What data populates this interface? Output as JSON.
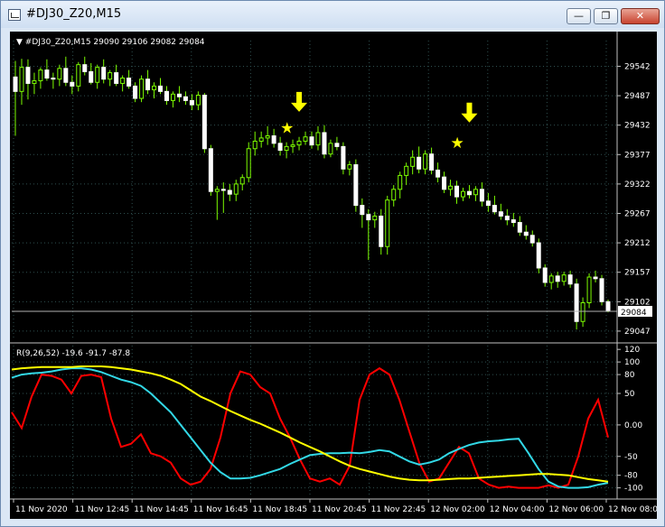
{
  "window": {
    "title": "#DJ30_Z20,M15",
    "minimize_glyph": "—",
    "maximize_glyph": "❐",
    "close_glyph": "✕"
  },
  "chart_header": {
    "symbol_info": "▼ #DJ30_Z20,M15  29090 29106 29082 29084"
  },
  "indicator_header": {
    "label": "R(9,26,52) -19.6 -91.7 -87.8"
  },
  "colors": {
    "background": "#000000",
    "candle": "#7CFC00",
    "grid": "#2f4f4f",
    "annotation": "#ffff00",
    "indicator_red": "#ff0000",
    "indicator_cyan": "#32d8e6",
    "indicator_yellow": "#ffff00"
  },
  "chart_data": [
    {
      "type": "candlestick",
      "title": "#DJ30_Z20,M15",
      "y_ticks": [
        29542,
        29487,
        29432,
        29377,
        29322,
        29267,
        29212,
        29157,
        29102,
        29047
      ],
      "ylim": [
        29030,
        29590
      ],
      "current_price": 29084,
      "x_ticks": [
        "11 Nov 2020",
        "11 Nov 12:45",
        "11 Nov 14:45",
        "11 Nov 16:45",
        "11 Nov 18:45",
        "11 Nov 20:45",
        "11 Nov 22:45",
        "12 Nov 02:00",
        "12 Nov 04:00",
        "12 Nov 06:00",
        "12 Nov 08:00"
      ],
      "grid": true,
      "annotations": [
        {
          "type": "star",
          "candle_index": 43,
          "price": 29427
        },
        {
          "type": "arrow-down",
          "candle_index": 45,
          "price": 29467
        },
        {
          "type": "star",
          "candle_index": 70,
          "price": 29399
        },
        {
          "type": "arrow-down",
          "candle_index": 72,
          "price": 29447
        }
      ],
      "candles": [
        {
          "o": 29522,
          "h": 29552,
          "l": 29412,
          "c": 29495
        },
        {
          "o": 29495,
          "h": 29556,
          "l": 29470,
          "c": 29540
        },
        {
          "o": 29540,
          "h": 29555,
          "l": 29480,
          "c": 29510
        },
        {
          "o": 29510,
          "h": 29530,
          "l": 29490,
          "c": 29515
        },
        {
          "o": 29515,
          "h": 29540,
          "l": 29500,
          "c": 29535
        },
        {
          "o": 29535,
          "h": 29555,
          "l": 29515,
          "c": 29520
        },
        {
          "o": 29520,
          "h": 29530,
          "l": 29500,
          "c": 29518
        },
        {
          "o": 29518,
          "h": 29545,
          "l": 29505,
          "c": 29538
        },
        {
          "o": 29538,
          "h": 29560,
          "l": 29505,
          "c": 29512
        },
        {
          "o": 29512,
          "h": 29525,
          "l": 29490,
          "c": 29505
        },
        {
          "o": 29505,
          "h": 29550,
          "l": 29495,
          "c": 29545
        },
        {
          "o": 29545,
          "h": 29560,
          "l": 29525,
          "c": 29532
        },
        {
          "o": 29532,
          "h": 29548,
          "l": 29508,
          "c": 29512
        },
        {
          "o": 29512,
          "h": 29545,
          "l": 29500,
          "c": 29540
        },
        {
          "o": 29540,
          "h": 29555,
          "l": 29510,
          "c": 29518
        },
        {
          "o": 29518,
          "h": 29535,
          "l": 29505,
          "c": 29530
        },
        {
          "o": 29530,
          "h": 29545,
          "l": 29505,
          "c": 29510
        },
        {
          "o": 29510,
          "h": 29525,
          "l": 29495,
          "c": 29520
        },
        {
          "o": 29520,
          "h": 29535,
          "l": 29500,
          "c": 29505
        },
        {
          "o": 29505,
          "h": 29512,
          "l": 29475,
          "c": 29482
        },
        {
          "o": 29482,
          "h": 29525,
          "l": 29475,
          "c": 29518
        },
        {
          "o": 29518,
          "h": 29535,
          "l": 29490,
          "c": 29498
        },
        {
          "o": 29498,
          "h": 29512,
          "l": 29482,
          "c": 29505
        },
        {
          "o": 29505,
          "h": 29520,
          "l": 29490,
          "c": 29495
        },
        {
          "o": 29495,
          "h": 29505,
          "l": 29470,
          "c": 29478
        },
        {
          "o": 29478,
          "h": 29495,
          "l": 29465,
          "c": 29490
        },
        {
          "o": 29490,
          "h": 29505,
          "l": 29475,
          "c": 29485
        },
        {
          "o": 29485,
          "h": 29495,
          "l": 29470,
          "c": 29478
        },
        {
          "o": 29478,
          "h": 29490,
          "l": 29460,
          "c": 29470
        },
        {
          "o": 29470,
          "h": 29495,
          "l": 29460,
          "c": 29488
        },
        {
          "o": 29488,
          "h": 29492,
          "l": 29380,
          "c": 29388
        },
        {
          "o": 29388,
          "h": 29395,
          "l": 29300,
          "c": 29308
        },
        {
          "o": 29308,
          "h": 29318,
          "l": 29255,
          "c": 29312
        },
        {
          "o": 29312,
          "h": 29325,
          "l": 29268,
          "c": 29310
        },
        {
          "o": 29310,
          "h": 29322,
          "l": 29290,
          "c": 29303
        },
        {
          "o": 29303,
          "h": 29330,
          "l": 29290,
          "c": 29322
        },
        {
          "o": 29322,
          "h": 29340,
          "l": 29310,
          "c": 29334
        },
        {
          "o": 29334,
          "h": 29400,
          "l": 29325,
          "c": 29388
        },
        {
          "o": 29388,
          "h": 29420,
          "l": 29375,
          "c": 29402
        },
        {
          "o": 29402,
          "h": 29420,
          "l": 29390,
          "c": 29408
        },
        {
          "o": 29408,
          "h": 29430,
          "l": 29395,
          "c": 29412
        },
        {
          "o": 29412,
          "h": 29425,
          "l": 29390,
          "c": 29398
        },
        {
          "o": 29398,
          "h": 29410,
          "l": 29375,
          "c": 29385
        },
        {
          "o": 29385,
          "h": 29400,
          "l": 29370,
          "c": 29392
        },
        {
          "o": 29392,
          "h": 29405,
          "l": 29380,
          "c": 29395
        },
        {
          "o": 29395,
          "h": 29410,
          "l": 29385,
          "c": 29402
        },
        {
          "o": 29402,
          "h": 29420,
          "l": 29395,
          "c": 29410
        },
        {
          "o": 29410,
          "h": 29420,
          "l": 29388,
          "c": 29395
        },
        {
          "o": 29395,
          "h": 29430,
          "l": 29385,
          "c": 29418
        },
        {
          "o": 29418,
          "h": 29432,
          "l": 29370,
          "c": 29378
        },
        {
          "o": 29378,
          "h": 29405,
          "l": 29372,
          "c": 29398
        },
        {
          "o": 29398,
          "h": 29410,
          "l": 29385,
          "c": 29392
        },
        {
          "o": 29392,
          "h": 29400,
          "l": 29340,
          "c": 29350
        },
        {
          "o": 29350,
          "h": 29365,
          "l": 29338,
          "c": 29358
        },
        {
          "o": 29358,
          "h": 29368,
          "l": 29270,
          "c": 29282
        },
        {
          "o": 29282,
          "h": 29295,
          "l": 29240,
          "c": 29265
        },
        {
          "o": 29265,
          "h": 29275,
          "l": 29180,
          "c": 29255
        },
        {
          "o": 29255,
          "h": 29270,
          "l": 29240,
          "c": 29262
        },
        {
          "o": 29262,
          "h": 29275,
          "l": 29190,
          "c": 29205
        },
        {
          "o": 29205,
          "h": 29300,
          "l": 29190,
          "c": 29292
        },
        {
          "o": 29292,
          "h": 29320,
          "l": 29280,
          "c": 29312
        },
        {
          "o": 29312,
          "h": 29345,
          "l": 29295,
          "c": 29338
        },
        {
          "o": 29338,
          "h": 29362,
          "l": 29320,
          "c": 29355
        },
        {
          "o": 29355,
          "h": 29385,
          "l": 29340,
          "c": 29372
        },
        {
          "o": 29372,
          "h": 29392,
          "l": 29342,
          "c": 29350
        },
        {
          "o": 29350,
          "h": 29385,
          "l": 29340,
          "c": 29378
        },
        {
          "o": 29378,
          "h": 29390,
          "l": 29340,
          "c": 29348
        },
        {
          "o": 29348,
          "h": 29362,
          "l": 29325,
          "c": 29335
        },
        {
          "o": 29335,
          "h": 29345,
          "l": 29305,
          "c": 29312
        },
        {
          "o": 29312,
          "h": 29330,
          "l": 29300,
          "c": 29318
        },
        {
          "o": 29318,
          "h": 29328,
          "l": 29285,
          "c": 29298
        },
        {
          "o": 29298,
          "h": 29315,
          "l": 29290,
          "c": 29308
        },
        {
          "o": 29308,
          "h": 29320,
          "l": 29295,
          "c": 29302
        },
        {
          "o": 29302,
          "h": 29318,
          "l": 29290,
          "c": 29312
        },
        {
          "o": 29312,
          "h": 29325,
          "l": 29280,
          "c": 29290
        },
        {
          "o": 29290,
          "h": 29305,
          "l": 29270,
          "c": 29282
        },
        {
          "o": 29282,
          "h": 29300,
          "l": 29265,
          "c": 29270
        },
        {
          "o": 29270,
          "h": 29285,
          "l": 29255,
          "c": 29262
        },
        {
          "o": 29262,
          "h": 29275,
          "l": 29245,
          "c": 29255
        },
        {
          "o": 29255,
          "h": 29268,
          "l": 29242,
          "c": 29250
        },
        {
          "o": 29250,
          "h": 29262,
          "l": 29225,
          "c": 29232
        },
        {
          "o": 29232,
          "h": 29245,
          "l": 29218,
          "c": 29226
        },
        {
          "o": 29226,
          "h": 29235,
          "l": 29205,
          "c": 29212
        },
        {
          "o": 29212,
          "h": 29220,
          "l": 29155,
          "c": 29165
        },
        {
          "o": 29165,
          "h": 29172,
          "l": 29130,
          "c": 29138
        },
        {
          "o": 29138,
          "h": 29155,
          "l": 29125,
          "c": 29150
        },
        {
          "o": 29150,
          "h": 29158,
          "l": 29128,
          "c": 29140
        },
        {
          "o": 29140,
          "h": 29158,
          "l": 29132,
          "c": 29152
        },
        {
          "o": 29152,
          "h": 29160,
          "l": 29128,
          "c": 29135
        },
        {
          "o": 29135,
          "h": 29145,
          "l": 29050,
          "c": 29065
        },
        {
          "o": 29065,
          "h": 29110,
          "l": 29055,
          "c": 29100
        },
        {
          "o": 29100,
          "h": 29155,
          "l": 29090,
          "c": 29148
        },
        {
          "o": 29148,
          "h": 29160,
          "l": 29138,
          "c": 29145
        },
        {
          "o": 29145,
          "h": 29152,
          "l": 29095,
          "c": 29102
        },
        {
          "o": 29102,
          "h": 29106,
          "l": 29082,
          "c": 29084
        }
      ]
    },
    {
      "type": "line",
      "title": "R(9,26,52) -19.6 -91.7 -87.8",
      "ylim": [
        -112,
        126
      ],
      "y_ticks": [
        120,
        100,
        80,
        50,
        0.0,
        -50,
        -80,
        -100
      ],
      "grid": true,
      "x_ticks": [
        "11 Nov 2020",
        "11 Nov 12:45",
        "11 Nov 14:45",
        "11 Nov 16:45",
        "11 Nov 18:45",
        "11 Nov 20:45",
        "11 Nov 22:45",
        "12 Nov 02:00",
        "12 Nov 04:00",
        "12 Nov 06:00",
        "12 Nov 08:00"
      ],
      "series": [
        {
          "color": "#ff0000",
          "values": [
            20,
            -5,
            45,
            80,
            78,
            72,
            50,
            78,
            80,
            76,
            10,
            -35,
            -30,
            -15,
            -45,
            -50,
            -60,
            -85,
            -95,
            -90,
            -70,
            -20,
            50,
            85,
            80,
            60,
            50,
            10,
            -20,
            -55,
            -85,
            -90,
            -85,
            -95,
            -65,
            40,
            80,
            90,
            80,
            40,
            -10,
            -60,
            -90,
            -85,
            -60,
            -35,
            -45,
            -85,
            -95,
            -100,
            -98,
            -100,
            -100,
            -100,
            -96,
            -100,
            -95,
            -50,
            10,
            40,
            -20
          ]
        },
        {
          "color": "#32d8e6",
          "values": [
            75,
            80,
            82,
            83,
            85,
            88,
            90,
            90,
            88,
            84,
            78,
            72,
            68,
            62,
            50,
            35,
            20,
            0,
            -20,
            -40,
            -60,
            -75,
            -85,
            -85,
            -84,
            -80,
            -75,
            -70,
            -62,
            -55,
            -48,
            -46,
            -45,
            -45,
            -44,
            -45,
            -43,
            -40,
            -42,
            -50,
            -58,
            -63,
            -60,
            -55,
            -45,
            -38,
            -32,
            -28,
            -26,
            -25,
            -23,
            -22,
            -45,
            -70,
            -90,
            -98,
            -100,
            -100,
            -99,
            -95,
            -92
          ]
        },
        {
          "color": "#ffff00",
          "values": [
            88,
            90,
            91,
            92,
            92,
            92,
            92,
            93,
            93,
            93,
            92,
            90,
            88,
            85,
            82,
            78,
            72,
            65,
            55,
            45,
            38,
            30,
            22,
            15,
            8,
            2,
            -5,
            -12,
            -20,
            -28,
            -35,
            -42,
            -50,
            -58,
            -65,
            -70,
            -74,
            -78,
            -82,
            -85,
            -87,
            -88,
            -88,
            -87,
            -86,
            -85,
            -85,
            -84,
            -83,
            -82,
            -81,
            -80,
            -79,
            -78,
            -78,
            -79,
            -80,
            -83,
            -86,
            -88,
            -90
          ]
        }
      ]
    }
  ]
}
